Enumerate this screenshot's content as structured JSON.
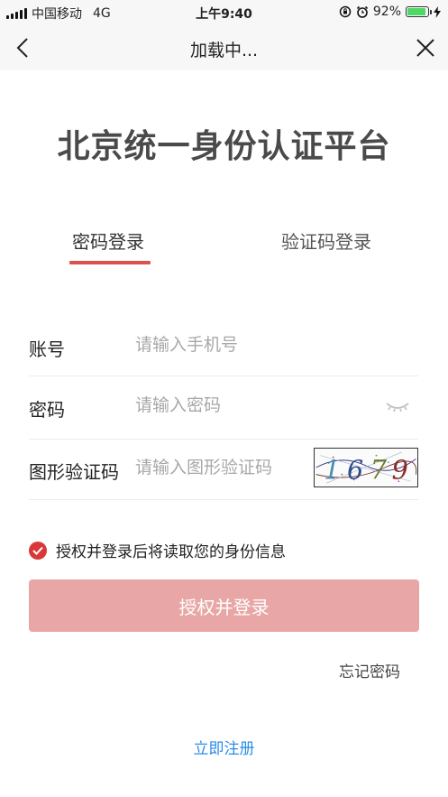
{
  "status_bar": {
    "carrier": "中国移动",
    "network": "4G",
    "time": "上午9:40",
    "battery_percent": "92%",
    "battery_level": 0.92
  },
  "nav": {
    "title": "加载中...",
    "back_icon": "chevron-left-icon",
    "close_icon": "close-icon"
  },
  "platform_title": "北京统一身份认证平台",
  "tabs": [
    {
      "label": "密码登录",
      "active": true
    },
    {
      "label": "验证码登录",
      "active": false
    }
  ],
  "form": {
    "account": {
      "label": "账号",
      "placeholder": "请输入手机号",
      "value": ""
    },
    "password": {
      "label": "密码",
      "placeholder": "请输入密码",
      "value": ""
    },
    "captcha": {
      "label": "图形验证码",
      "placeholder": "请输入图形验证码",
      "value": "",
      "image_text": "1679"
    }
  },
  "agreement": {
    "text": "授权并登录后将读取您的身份信息",
    "checked": true
  },
  "login_button": "授权并登录",
  "forgot_password": "忘记密码",
  "register_link": "立即注册",
  "colors": {
    "accent": "#d9524f",
    "login_button_bg": "#e8a7a6",
    "link": "#2b8ce8",
    "check": "#d9383a"
  }
}
